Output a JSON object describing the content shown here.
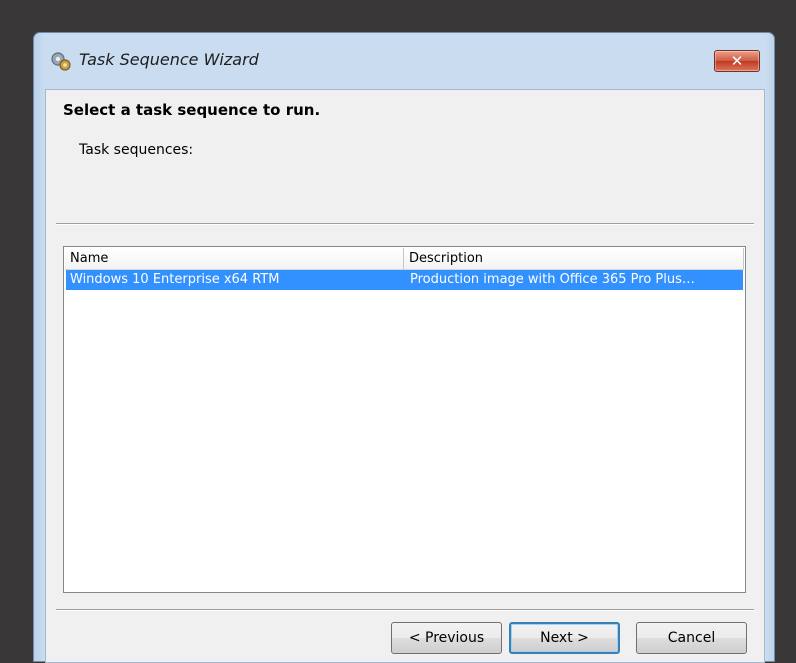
{
  "window": {
    "title": "Task Sequence Wizard",
    "close_glyph": "✕",
    "title_icon": "wizard-gears-icon"
  },
  "page": {
    "heading": "Select a task sequence to run.",
    "label": "Task sequences:"
  },
  "list": {
    "columns": [
      "Name",
      "Description"
    ],
    "rows": [
      {
        "name": "Windows 10 Enterprise x64 RTM",
        "description": "Production image with Office 365 Pro Plus…",
        "selected": true
      }
    ]
  },
  "buttons": {
    "previous": "< Previous",
    "next": "Next >",
    "cancel": "Cancel"
  },
  "colors": {
    "selection": "#3390ff",
    "close_button": "#c0391f"
  }
}
